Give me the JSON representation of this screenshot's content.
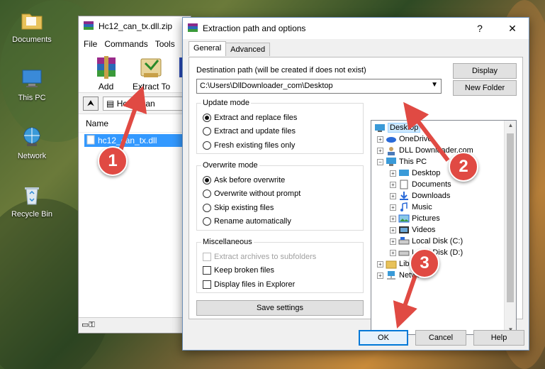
{
  "desktop": {
    "icons": [
      {
        "label": "Documents"
      },
      {
        "label": "This PC"
      },
      {
        "label": "Network"
      },
      {
        "label": "Recycle Bin"
      }
    ]
  },
  "winrar": {
    "title": "Hc12_can_tx.dll.zip",
    "menu": [
      "File",
      "Commands",
      "Tools"
    ],
    "toolbar": {
      "add": "Add",
      "extract_to": "Extract To"
    },
    "path": "Hc12_can",
    "column_name": "Name",
    "file": "hc12_can_tx.dll"
  },
  "dialog": {
    "title": "Extraction path and options",
    "help_glyph": "?",
    "close_glyph": "✕",
    "tabs": [
      "General",
      "Advanced"
    ],
    "dest_label": "Destination path (will be created if does not exist)",
    "dest_value": "C:\\Users\\DllDownloader_com\\Desktop",
    "display_btn": "Display",
    "new_folder_btn": "New Folder",
    "update_mode": {
      "title": "Update mode",
      "options": [
        "Extract and replace files",
        "Extract and update files",
        "Fresh existing files only"
      ],
      "selected": 0
    },
    "overwrite_mode": {
      "title": "Overwrite mode",
      "options": [
        "Ask before overwrite",
        "Overwrite without prompt",
        "Skip existing files",
        "Rename automatically"
      ],
      "selected": 0
    },
    "misc": {
      "title": "Miscellaneous",
      "options": [
        "Extract archives to subfolders",
        "Keep broken files",
        "Display files in Explorer"
      ]
    },
    "save_settings": "Save settings",
    "tree": {
      "desktop": "Desktop",
      "onedrive": "OneDrive",
      "dlldownloader": "DLL Downloader.com",
      "thispc": "This PC",
      "pc_desktop": "Desktop",
      "documents": "Documents",
      "downloads": "Downloads",
      "music": "Music",
      "pictures": "Pictures",
      "videos": "Videos",
      "local_c": "Local Disk (C:)",
      "local_d": "Local Disk (D:)",
      "libraries": "Libraries",
      "network": "Network"
    },
    "ok": "OK",
    "cancel": "Cancel",
    "help": "Help"
  },
  "callouts": [
    "1",
    "2",
    "3"
  ],
  "colors": {
    "callout": "#e04a43",
    "selection": "#3399ff",
    "tree_selection": "#cce8ff"
  }
}
